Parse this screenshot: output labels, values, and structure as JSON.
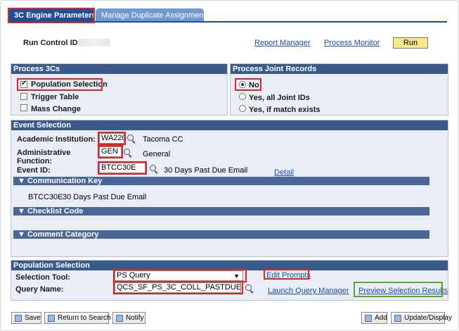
{
  "tabs": {
    "active": "3C Engine Parameters",
    "inactive": "Manage Duplicate Assignment"
  },
  "header": {
    "run_control_label": "Run Control ID:",
    "report_manager": "Report Manager",
    "process_monitor": "Process Monitor",
    "run_label": "Run"
  },
  "process3cs": {
    "title": "Process 3Cs",
    "options": [
      {
        "label": "Population Selection",
        "checked": true
      },
      {
        "label": "Trigger Table",
        "checked": false
      },
      {
        "label": "Mass Change",
        "checked": false
      }
    ]
  },
  "joint": {
    "title": "Process Joint Records",
    "options": [
      {
        "label": "No",
        "selected": true
      },
      {
        "label": "Yes, all Joint IDs",
        "selected": false
      },
      {
        "label": "Yes, if match exists",
        "selected": false
      }
    ]
  },
  "event": {
    "title": "Event Selection",
    "institution_label": "Academic Institution:",
    "institution_value": "WA220",
    "institution_desc": "Tacoma CC",
    "admin_label": "Administrative Function:",
    "admin_value": "GEN",
    "admin_desc": "General",
    "event_label": "Event ID:",
    "event_value": "BTCC30E",
    "event_desc": "30 Days Past Due Email",
    "detail_link": "Detail",
    "comm_key_title": "Communication Key",
    "comm_key_id": "BTCC30E",
    "comm_key_desc": "30 Days Past Due Email",
    "checklist_title": "Checklist Code",
    "comment_title": "Comment Category"
  },
  "population": {
    "title": "Population Selection",
    "tool_label": "Selection Tool:",
    "tool_value": "PS Query",
    "edit_prompts": "Edit Prompts",
    "query_label": "Query Name:",
    "query_value": "QCS_SF_PS_3C_COLL_PASTDUE",
    "launch_query": "Launch Query Manager",
    "preview": "Preview Selection Results"
  },
  "footer": {
    "save": "Save",
    "return": "Return to Search",
    "notify": "Notify",
    "add": "Add",
    "update": "Update/Display"
  },
  "colors": {
    "header_blue": "#3a5a8c",
    "tab_blue": "#1f4e97",
    "highlight_red": "#e02424",
    "highlight_green": "#5aa832",
    "run_yellow": "#f6e98a"
  }
}
